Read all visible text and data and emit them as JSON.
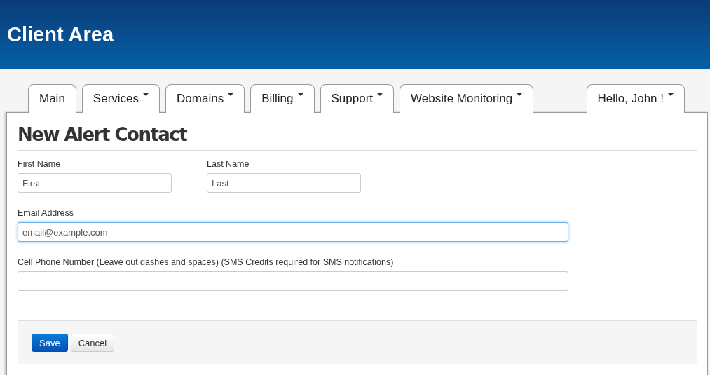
{
  "header": {
    "title": "Client Area"
  },
  "nav": {
    "tabs": [
      {
        "label": "Main",
        "dropdown": false
      },
      {
        "label": "Services",
        "dropdown": true
      },
      {
        "label": "Domains",
        "dropdown": true
      },
      {
        "label": "Billing",
        "dropdown": true
      },
      {
        "label": "Support",
        "dropdown": true
      },
      {
        "label": "Website Monitoring",
        "dropdown": true
      }
    ],
    "user_menu": {
      "label": "Hello, John !",
      "dropdown": true
    }
  },
  "form": {
    "title": "New Alert Contact",
    "name_fields": [
      {
        "label": "First Name",
        "placeholder": "First",
        "focused": false
      },
      {
        "label": "Last Name",
        "placeholder": "Last",
        "focused": false
      }
    ],
    "fields": [
      {
        "label": "Email Address",
        "placeholder": "email@example.com",
        "focused": true
      },
      {
        "label": "Cell Phone Number (Leave out dashes and spaces) (SMS Credits required for SMS notifications)",
        "focused": false
      }
    ],
    "buttons": [
      {
        "label": "Save",
        "kind": "primary"
      },
      {
        "label": "Cancel",
        "kind": "default"
      }
    ]
  }
}
